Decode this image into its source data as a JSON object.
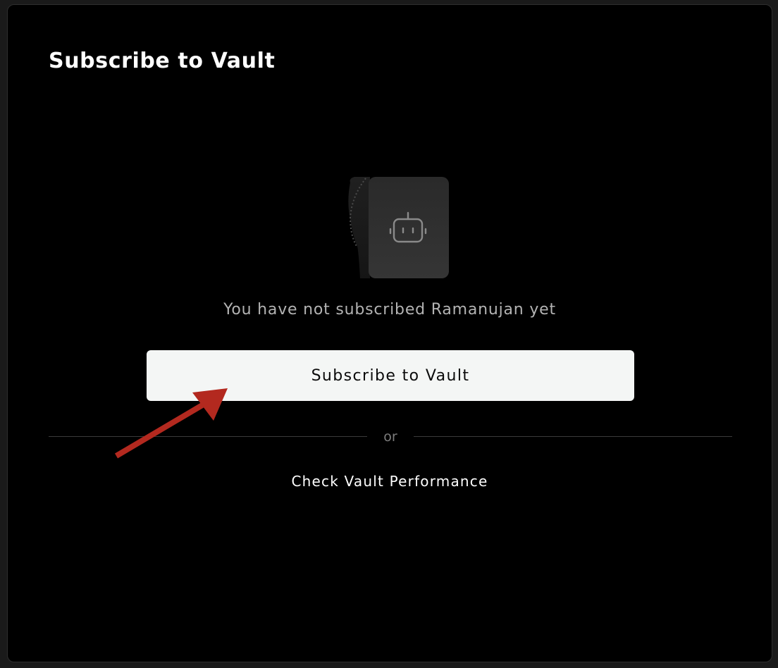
{
  "dialog": {
    "title": "Subscribe to Vault",
    "empty_message": "You have not subscribed Ramanujan yet",
    "subscribe_button": "Subscribe to Vault",
    "divider_label": "or",
    "performance_link": "Check Vault Performance"
  },
  "icons": {
    "illustration": "robot-card-icon",
    "annotation": "red-arrow-annotation"
  },
  "colors": {
    "background": "#000000",
    "button_bg": "#f4f6f5",
    "muted_text": "#b3b3b3",
    "annotation_arrow": "#b3291f"
  }
}
